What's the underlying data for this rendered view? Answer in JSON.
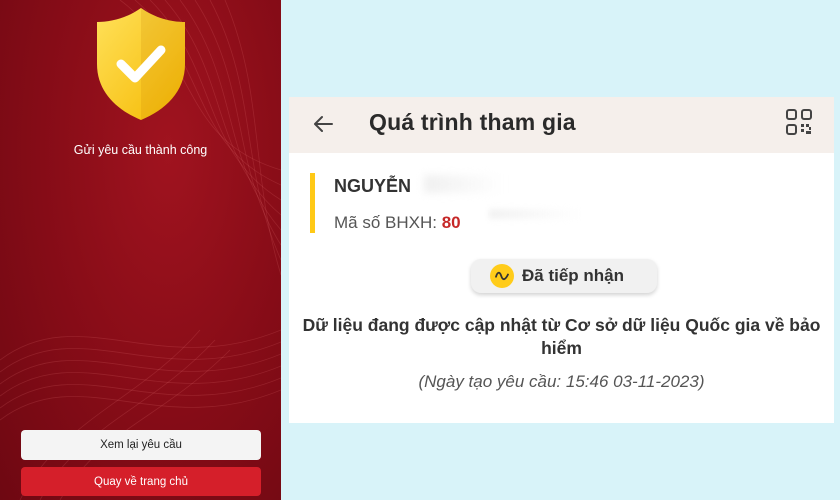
{
  "left_screen": {
    "success_message": "Gửi yêu cầu thành công",
    "review_button": "Xem lại yêu cầu",
    "home_button": "Quay về trang chủ",
    "colors": {
      "background": "#8a0d18",
      "primary_button": "#d51f2a",
      "shield": "#ffc916"
    },
    "icons": [
      "shield-check-icon"
    ]
  },
  "right_screen": {
    "header": {
      "title": "Quá trình tham gia",
      "back_icon": "arrow-left-icon",
      "qr_icon": "qr-code-icon"
    },
    "participant": {
      "name": "NGUYỄN",
      "bhxh_label": "Mã số BHXH:",
      "bhxh_number": "80"
    },
    "status": {
      "label": "Đã tiếp nhận",
      "icon": "wave-icon"
    },
    "message": "Dữ liệu đang được cập nhật từ Cơ sở dữ liệu Quốc gia về bảo hiểm",
    "request_date": "(Ngày tạo yêu cầu: 15:46 03-11-2023)",
    "colors": {
      "accent": "#ffc916",
      "number": "#c62828",
      "background": "#d8f3f9"
    }
  }
}
